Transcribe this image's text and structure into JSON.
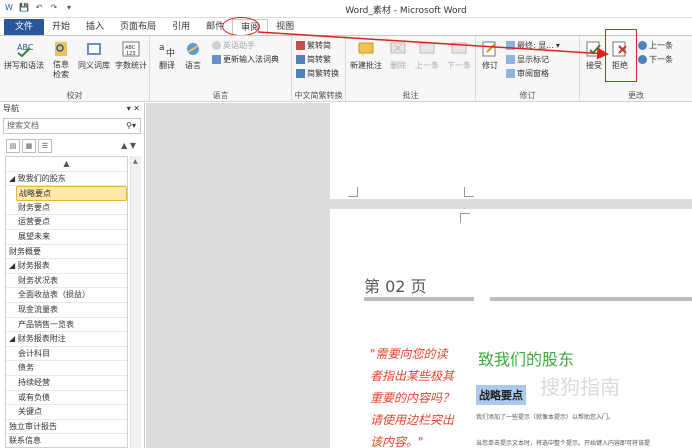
{
  "window": {
    "title": "Word_素材 - Microsoft Word"
  },
  "qat": [
    "W",
    "💾",
    "↶",
    "↷",
    "▾"
  ],
  "tabs": [
    "文件",
    "开始",
    "插入",
    "页面布局",
    "引用",
    "邮件",
    "审阅",
    "视图"
  ],
  "ribbon": {
    "groups": {
      "proofing": {
        "label": "校对",
        "buttons": [
          "拼写和语法",
          "信息检索",
          "同义词库",
          "字数统计"
        ]
      },
      "language": {
        "label": "语言",
        "buttons": [
          "翻译",
          "语言"
        ],
        "small": [
          "英语助手",
          "更新输入法词典"
        ]
      },
      "chinese": {
        "label": "中文简繁转换",
        "small": [
          "繁转简",
          "简转繁",
          "简繁转换"
        ]
      },
      "comments": {
        "label": "批注",
        "buttons": [
          "新建批注",
          "删除",
          "上一条",
          "下一条"
        ]
      },
      "tracking": {
        "label": "修订",
        "buttons": [
          "修订"
        ],
        "small": [
          "最终: 显...",
          "显示标记",
          "审阅窗格"
        ]
      },
      "changes": {
        "label": "更改",
        "buttons": [
          "接受",
          "拒绝"
        ],
        "small": [
          "上一条",
          "下一条"
        ]
      }
    }
  },
  "nav": {
    "title": "导航",
    "search_placeholder": "搜索文档",
    "items": [
      {
        "label": "▲",
        "level": "close"
      },
      {
        "label": "◢ 致我们的股东",
        "level": "l1"
      },
      {
        "label": "战略要点",
        "level": "sel"
      },
      {
        "label": "财务要点",
        "level": "l2"
      },
      {
        "label": "运营要点",
        "level": "l2"
      },
      {
        "label": "展望未来",
        "level": "l2"
      },
      {
        "label": "财务概要",
        "level": "top"
      },
      {
        "label": "◢ 财务报表",
        "level": "l1"
      },
      {
        "label": "财务状况表",
        "level": "l2"
      },
      {
        "label": "全面收益表（损益）",
        "level": "l2"
      },
      {
        "label": "现金流量表",
        "level": "l2"
      },
      {
        "label": "产品销售一览表",
        "level": "l2"
      },
      {
        "label": "◢ 财务报表附注",
        "level": "l1"
      },
      {
        "label": "会计科目",
        "level": "l2"
      },
      {
        "label": "债务",
        "level": "l2"
      },
      {
        "label": "持续经营",
        "level": "l2"
      },
      {
        "label": "或有负债",
        "level": "l2"
      },
      {
        "label": "关键点",
        "level": "l2"
      },
      {
        "label": "独立审计报告",
        "level": "top"
      },
      {
        "label": "联系信息",
        "level": "top"
      }
    ]
  },
  "document": {
    "page_title": "第 02 页",
    "sidebar_quote": "\"需要向您的读者指出某些极其重要的内容吗？请使用边栏突出该内容。\"",
    "heading1": "致我们的股东",
    "heading2": "战略要点",
    "body1": "我们添加了一些提示（就像本提示）以帮助您入门。",
    "body2": "当您单击提示文本时，将选中整个提示。开始键入内容即可将该提",
    "watermark": "搜狗指南"
  }
}
